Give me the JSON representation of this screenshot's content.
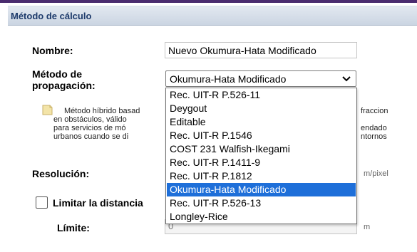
{
  "panel": {
    "title": "Método de cálculo"
  },
  "form": {
    "name_label": "Nombre:",
    "name_value": "Nuevo Okumura-Hata Modificado",
    "method_label_line1": "Método de",
    "method_label_line2": "propagación:",
    "method_selected": "Okumura-Hata Modificado",
    "description_lines": [
      "Método híbrido basad",
      "en obstáculos, válido",
      "para servicios de mó",
      "urbanos cuando se di"
    ],
    "description_right_lines": [
      "fraccion",
      "endado",
      "ntornos"
    ],
    "resolution_label": "Resolución:",
    "resolution_unit": "m/pixel",
    "limit_distance_label": "Limitar la distancia",
    "limit_label": "Límite:",
    "limit_value": "0",
    "limit_unit": "m"
  },
  "dropdown": {
    "options": [
      "Rec. UIT-R P.526-11",
      "Deygout",
      "Editable",
      "Rec. UIT-R P.1546",
      "COST 231 Walfish-Ikegami",
      "Rec. UIT-R P.1411-9",
      "Rec. UIT-R P.1812",
      "Okumura-Hata Modificado",
      "Rec. UIT-R P.526-13",
      "Longley-Rice"
    ],
    "selected_index": 7
  },
  "colors": {
    "accent": "#4a2b6e",
    "header_text": "#1d3a6b",
    "selected_option": "#1e6fd9"
  }
}
